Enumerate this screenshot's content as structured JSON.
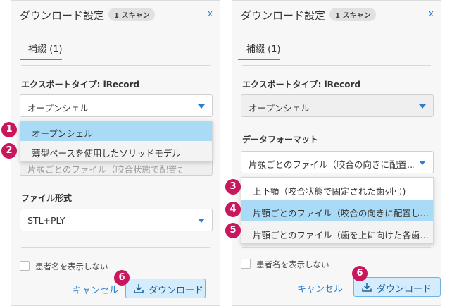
{
  "dialog": {
    "title": "ダウンロード設定",
    "scan_badge": "1 スキャン",
    "close": "x",
    "tab": "補綴 (1)"
  },
  "left": {
    "export_type_label": "エクスポートタイプ: iRecord",
    "export_type_value": "オープンシェル",
    "export_options": [
      "オープンシェル",
      "薄型ベースを使用したソリッドモデル"
    ],
    "hidden_value": "片顎ごとのファイル（咬合状態で配置さ",
    "file_format_label": "ファイル形式",
    "file_format_value": "STL+PLY",
    "hide_patient": "患者名を表示しない",
    "cancel": "キャンセル",
    "download": "ダウンロード"
  },
  "right": {
    "export_type_label": "エクスポートタイプ: iRecord",
    "export_type_value": "オープンシェル",
    "data_format_label": "データフォーマット",
    "data_format_value": "片顎ごとのファイル（咬合の向きに配置…",
    "format_options": [
      "上下顎（咬合状態で固定された歯列弓)",
      "片顎ごとのファイル（咬合の向きに配置し…",
      "片顎ごとのファイル（歯を上に向けた各歯…"
    ],
    "hide_patient": "患者名を表示しない",
    "cancel": "キャンセル",
    "download": "ダウンロード"
  },
  "markers": [
    "1",
    "2",
    "3",
    "4",
    "5",
    "6",
    "6"
  ],
  "colors": {
    "accent": "#2a7fd0",
    "highlight": "#a9daf6",
    "marker": "#c8175d"
  }
}
